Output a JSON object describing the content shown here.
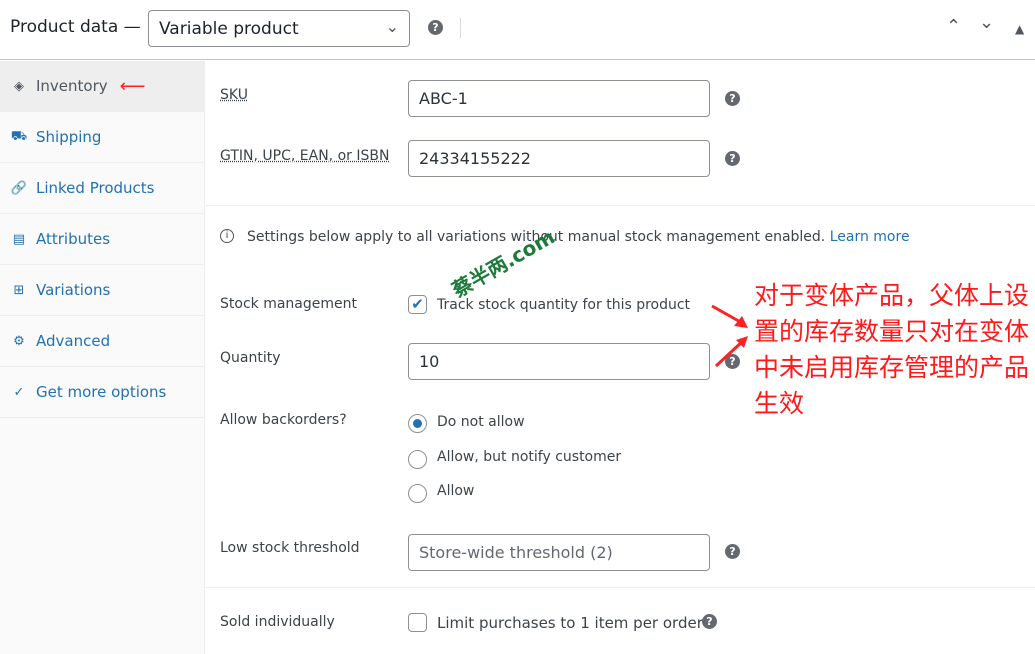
{
  "header": {
    "title": "Product data —",
    "product_type": "Variable product"
  },
  "sidebar": {
    "items": [
      {
        "label": "Inventory",
        "icon": "tag-icon"
      },
      {
        "label": "Shipping",
        "icon": "truck-icon"
      },
      {
        "label": "Linked Products",
        "icon": "link-icon"
      },
      {
        "label": "Attributes",
        "icon": "list-icon"
      },
      {
        "label": "Variations",
        "icon": "grid-icon"
      },
      {
        "label": "Advanced",
        "icon": "gear-icon"
      },
      {
        "label": "Get more options",
        "icon": "plug-icon"
      }
    ]
  },
  "fields": {
    "sku_label": "SKU",
    "sku_value": "ABC-1",
    "gtin_label": "GTIN, UPC, EAN, or ISBN",
    "gtin_value": "24334155222",
    "notice": "Settings below apply to all variations without manual stock management enabled.",
    "learn_more": "Learn more",
    "stock_label": "Stock management",
    "stock_checkbox": "Track stock quantity for this product",
    "stock_checked": true,
    "qty_label": "Quantity",
    "qty_value": "10",
    "backorders_label": "Allow backorders?",
    "backorder_options": [
      "Do not allow",
      "Allow, but notify customer",
      "Allow"
    ],
    "backorder_selected": "Do not allow",
    "low_label": "Low stock threshold",
    "low_placeholder": "Store-wide threshold (2)",
    "sold_label": "Sold individually",
    "sold_checkbox": "Limit purchases to 1 item per order",
    "sold_checked": false
  },
  "annotation": {
    "text": "对于变体产品，父体上设置的库存数量只对在变体中未启用库存管理的产品生效",
    "color": "#ff1a1a"
  },
  "watermark": "蔡半两.com",
  "colors": {
    "link": "#2271b1"
  }
}
